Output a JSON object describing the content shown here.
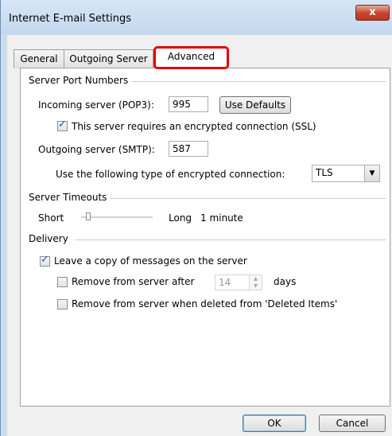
{
  "window": {
    "title": "Internet E-mail Settings",
    "close_label": "x"
  },
  "tabs": [
    {
      "label": "General",
      "active": false
    },
    {
      "label": "Outgoing Server",
      "active": false
    },
    {
      "label": "Advanced",
      "active": true
    }
  ],
  "server_ports": {
    "group_label": "Server Port Numbers",
    "incoming_label": "Incoming server (POP3):",
    "incoming_value": "995",
    "use_defaults_label": "Use Defaults",
    "ssl_checked": true,
    "ssl_label": "This server requires an encrypted connection (SSL)",
    "outgoing_label": "Outgoing server (SMTP):",
    "outgoing_value": "587",
    "encryption_label": "Use the following type of encrypted connection:",
    "encryption_value": "TLS"
  },
  "timeouts": {
    "group_label": "Server Timeouts",
    "short_label": "Short",
    "long_label": "Long",
    "value_label": "1 minute"
  },
  "delivery": {
    "group_label": "Delivery",
    "leave_copy_checked": true,
    "leave_copy_label": "Leave a copy of messages on the server",
    "remove_after_checked": false,
    "remove_after_label": "Remove from server after",
    "remove_after_days": "14",
    "days_label": "days",
    "remove_deleted_checked": false,
    "remove_deleted_label": "Remove from server when deleted from 'Deleted Items'"
  },
  "footer": {
    "ok_label": "OK",
    "cancel_label": "Cancel"
  },
  "colors": {
    "highlight_border": "#e00000",
    "close_button": "#c7432b"
  }
}
